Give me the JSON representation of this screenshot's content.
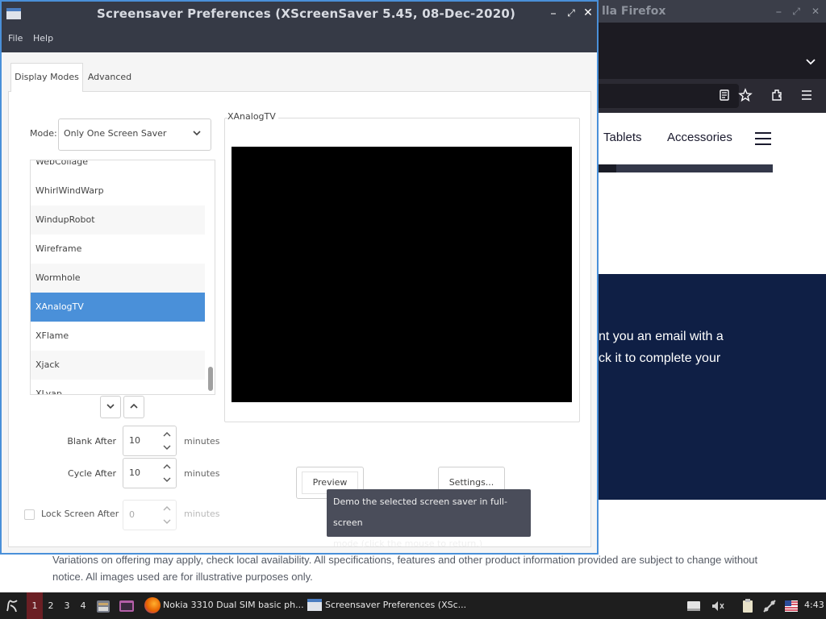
{
  "firefox": {
    "title": "lla Firefox",
    "site": {
      "nav_tablets": "Tablets",
      "nav_accessories": "Accessories",
      "banner_line1": "nt you an email with a",
      "banner_line2": "ck it to complete your",
      "disclaimer": "Variations on offering may apply, check local availability. All specifications, features and other product information provided are subject to change without notice. All images used are for illustrative purposes only."
    }
  },
  "screensaver": {
    "title": "Screensaver Preferences  (XScreenSaver 5.45, 08-Dec-2020)",
    "menu": [
      "File",
      "Help"
    ],
    "tabs": [
      "Display Modes",
      "Advanced"
    ],
    "mode_label": "Mode:",
    "mode_value": "Only One Screen Saver",
    "saver_list": [
      "WebCollage",
      "WhirlWindWarp",
      "WindupRobot",
      "Wireframe",
      "Wormhole",
      "XAnalogTV",
      "XFlame",
      "Xjack",
      "XLyap"
    ],
    "selected_saver": "XAnalogTV",
    "preview_frame_label": "XAnalogTV",
    "blank_after": {
      "label": "Blank After",
      "value": "10",
      "units": "minutes"
    },
    "cycle_after": {
      "label": "Cycle After",
      "value": "10",
      "units": "minutes"
    },
    "lock_screen": {
      "label": "Lock Screen After",
      "value": "0",
      "units": "minutes",
      "checked": false
    },
    "preview_button": "Preview",
    "settings_button": "Settings...",
    "tooltip_line1": "Demo the selected screen saver in full-screen",
    "tooltip_line2": "mode (click the mouse to return.)"
  },
  "taskbar": {
    "workspaces": [
      "1",
      "2",
      "3",
      "4"
    ],
    "active_workspace": "1",
    "firefox_task": "Nokia 3310 Dual SIM basic ph...",
    "screensaver_task": "Screensaver Preferences  (XSc...",
    "clock": "4:43"
  },
  "colors": {
    "accent": "#4a90d9",
    "titlebar": "#363a46",
    "banner": "#0f1f45",
    "active_workspace": "#6b1f24"
  }
}
